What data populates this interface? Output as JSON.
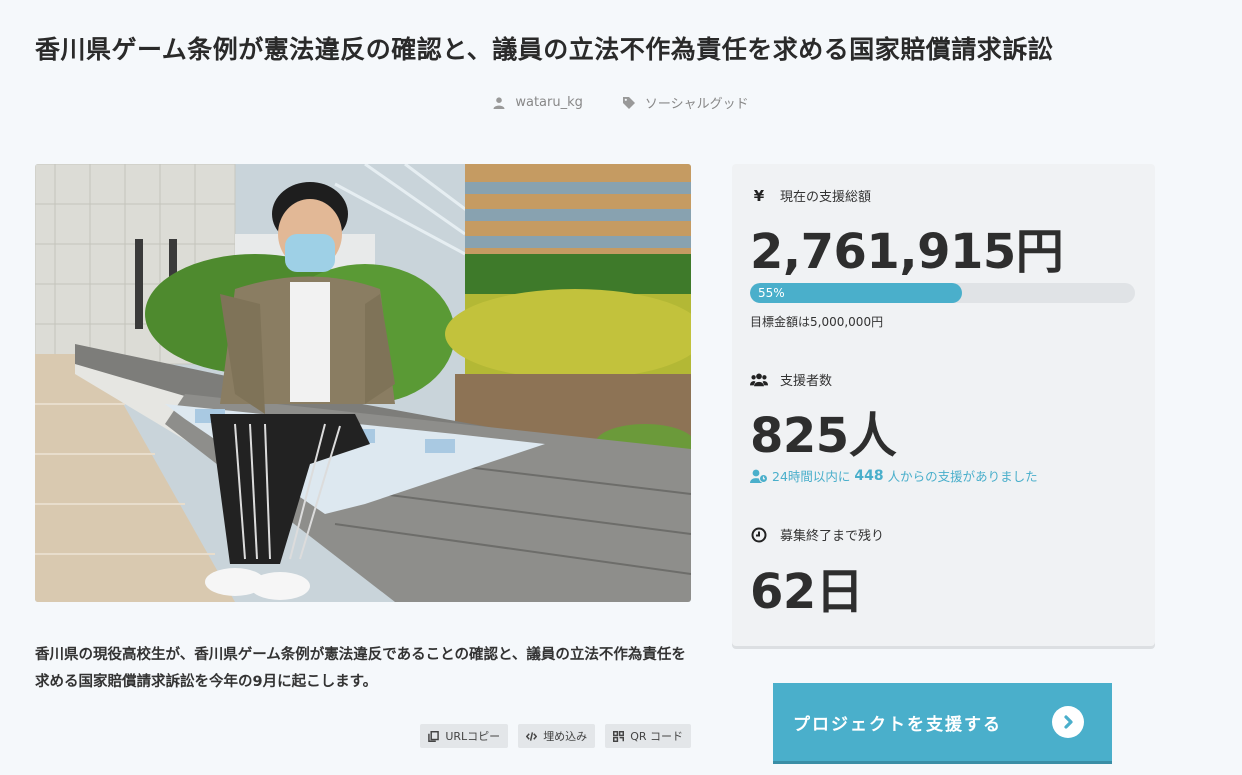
{
  "project": {
    "title": "香川県ゲーム条例が憲法違反の確認と、議員の立法不作為責任を求める国家賠償請求訴訟",
    "author": "wataru_kg",
    "category": "ソーシャルグッド",
    "description": "香川県の現役高校生が、香川県ゲーム条例が憲法違反であることの確認と、議員の立法不作為責任を求める国家賠償請求訴訟を今年の9月に起こします。"
  },
  "share": {
    "url_copy": "URLコピー",
    "embed": "埋め込み",
    "qr": "QR コード"
  },
  "stats": {
    "total_label": "現在の支援総額",
    "total_value": "2,761,915円",
    "progress_percent": 55,
    "progress_label": "55%",
    "goal_text": "目標金額は5,000,000円",
    "supporters_label": "支援者数",
    "supporters_value": "825人",
    "recent_prefix": "24時間以内に",
    "recent_count": "448",
    "recent_suffix": "人からの支援がありました",
    "remaining_label": "募集終了まで残り",
    "remaining_value": "62日"
  },
  "cta": {
    "support_label": "プロジェクトを支援する"
  },
  "colors": {
    "accent": "#4aafcb",
    "background": "#f5f8fb",
    "panel": "#f0f2f4"
  },
  "icons": {
    "author": "user-icon",
    "category": "tag-icon",
    "total": "yen-icon",
    "supporters": "users-icon",
    "recent": "user-clock-icon",
    "remaining": "clock-icon",
    "cta": "chevron-right-circle-icon"
  }
}
